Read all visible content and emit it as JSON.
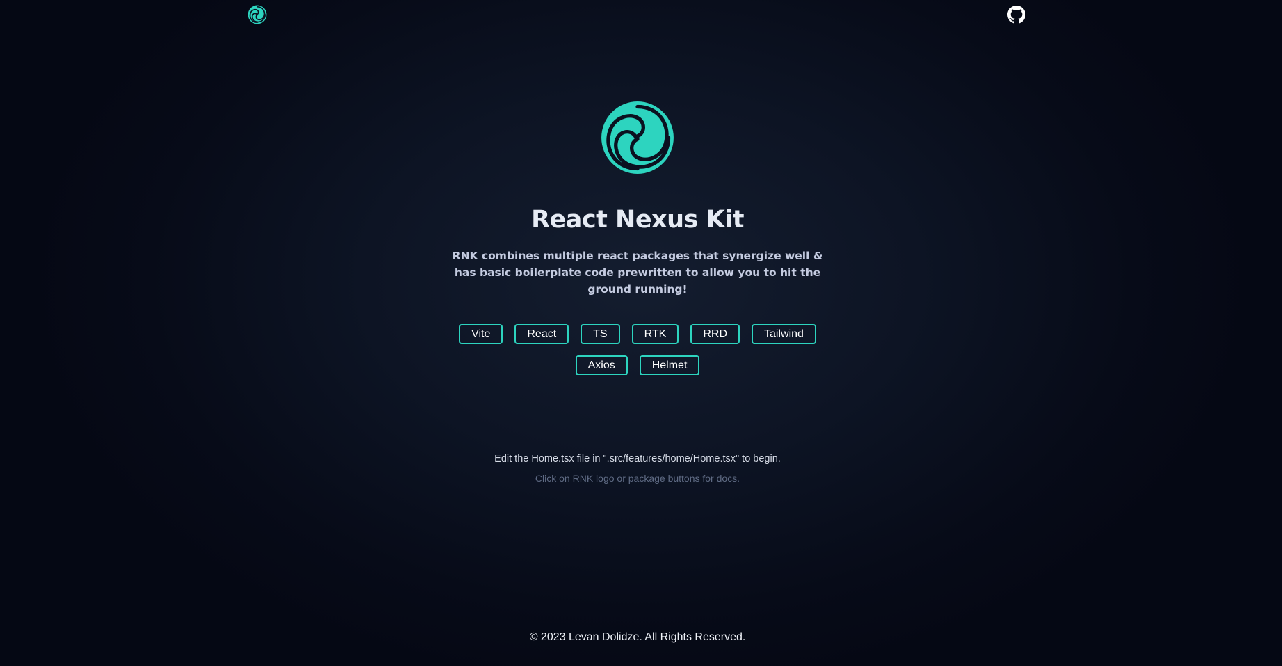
{
  "header": {
    "logo_icon": "rnk-swirl-logo-icon",
    "github_icon": "github-icon"
  },
  "hero": {
    "logo_icon": "rnk-swirl-logo-icon",
    "title": "React Nexus Kit",
    "subtitle": "RNK combines multiple react packages that synergize well & has basic boilerplate code prewritten to allow you to hit the ground running!"
  },
  "packages": [
    {
      "label": "Vite"
    },
    {
      "label": "React"
    },
    {
      "label": "TS"
    },
    {
      "label": "RTK"
    },
    {
      "label": "RRD"
    },
    {
      "label": "Tailwind"
    },
    {
      "label": "Axios"
    },
    {
      "label": "Helmet"
    }
  ],
  "hints": {
    "edit": "Edit the Home.tsx file in \".src/features/home/Home.tsx\" to begin.",
    "docs": "Click on RNK logo or package buttons for docs."
  },
  "footer": {
    "copyright": "© 2023 Levan Dolidze. All Rights Reserved."
  },
  "colors": {
    "accent": "#2dd4bf",
    "background": "#0d1424",
    "muted_text": "#5f6b84"
  }
}
